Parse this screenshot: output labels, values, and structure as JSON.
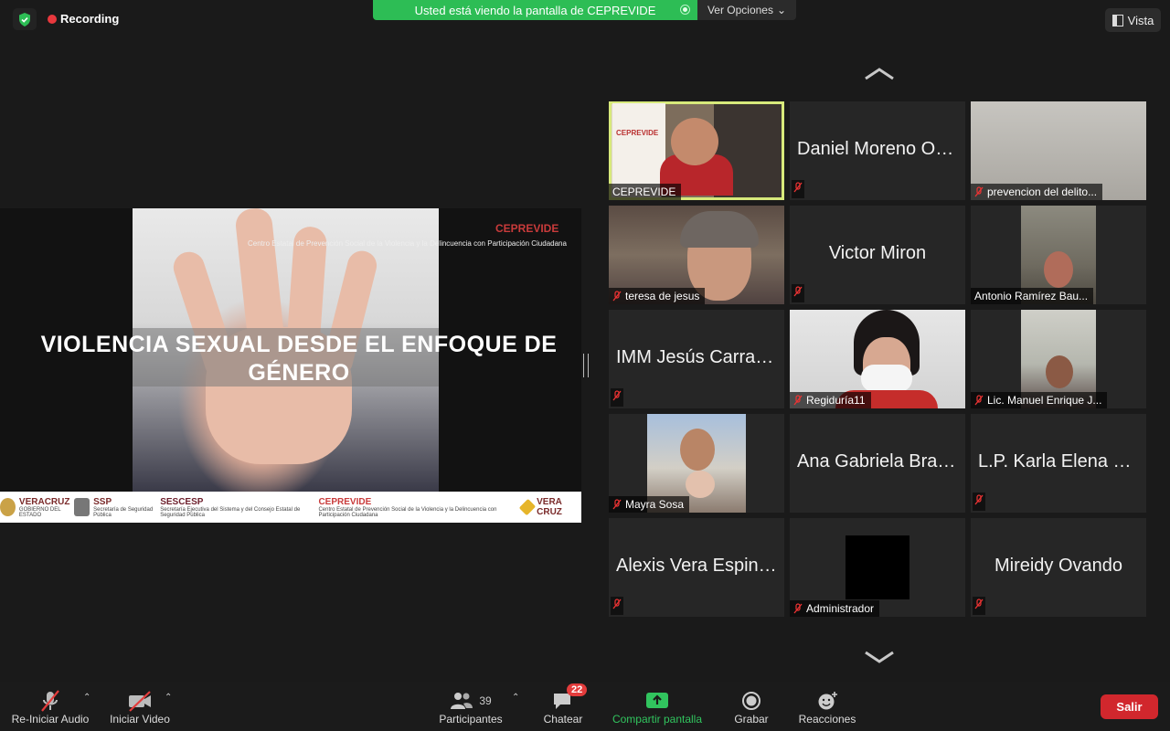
{
  "top": {
    "recording_label": "Recording",
    "share_banner": "Usted está viendo la pantalla de CEPREVIDE",
    "view_options": "Ver Opciones",
    "view_button": "Vista"
  },
  "slide": {
    "brand": "CEPREVIDE",
    "brand_subtitle": "Centro Estatal de Prevención Social de la Violencia y la Delincuencia con Participación Ciudadana",
    "title": "VIOLENCIA SEXUAL DESDE EL ENFOQUE DE GÉNERO",
    "logos": [
      {
        "name": "VERACRUZ",
        "sub": "GOBIERNO DEL ESTADO"
      },
      {
        "name": "SSP",
        "sub": "Secretaría de Seguridad Pública"
      },
      {
        "name": "SESCESP",
        "sub": "Secretaría Ejecutiva del Sistema y del Consejo Estatal de Seguridad Pública"
      },
      {
        "name": "CEPREVIDE",
        "sub": "Centro Estatal de Prevención Social de la Violencia y la Delincuencia con Participación Ciudadana"
      },
      {
        "name": "VERA CRUZ",
        "sub": ""
      }
    ]
  },
  "participants": [
    {
      "name": "CEPREVIDE",
      "display": "video",
      "muted": false,
      "active": true
    },
    {
      "name": "Daniel Moreno Ort...",
      "display": "name",
      "muted": true
    },
    {
      "name": "prevencion del delito...",
      "display": "video",
      "muted": true
    },
    {
      "name": "teresa de jesus",
      "display": "video",
      "muted": true
    },
    {
      "name": "Victor Miron",
      "display": "name",
      "muted": true
    },
    {
      "name": "Antonio Ramírez Bau...",
      "display": "video",
      "muted": false
    },
    {
      "name": "IMM Jesús Carran...",
      "display": "name",
      "muted": true
    },
    {
      "name": "Regiduría11",
      "display": "video",
      "muted": true
    },
    {
      "name": "Lic. Manuel Enrique J...",
      "display": "video",
      "muted": true
    },
    {
      "name": "Mayra Sosa",
      "display": "video",
      "muted": true
    },
    {
      "name": "Ana Gabriela Brav...",
      "display": "name",
      "muted": false
    },
    {
      "name": "L.P. Karla Elena DIF",
      "display": "name",
      "muted": true
    },
    {
      "name": "Alexis Vera Espino...",
      "display": "name",
      "muted": true
    },
    {
      "name": "Administrador",
      "display": "video",
      "muted": true
    },
    {
      "name": "Mireidy Ovando",
      "display": "name",
      "muted": true
    }
  ],
  "toolbar": {
    "audio": "Re-Iniciar Audio",
    "video": "Iniciar Video",
    "participants": "Participantes",
    "participants_count": "39",
    "chat": "Chatear",
    "chat_badge": "22",
    "share": "Compartir pantalla",
    "record": "Grabar",
    "reactions": "Reacciones",
    "leave": "Salir"
  },
  "colors": {
    "share_banner": "#2dbd55",
    "active_speaker_border": "#d7e97b",
    "leave_button": "#d1272d",
    "brand_red": "#c93b3b"
  }
}
